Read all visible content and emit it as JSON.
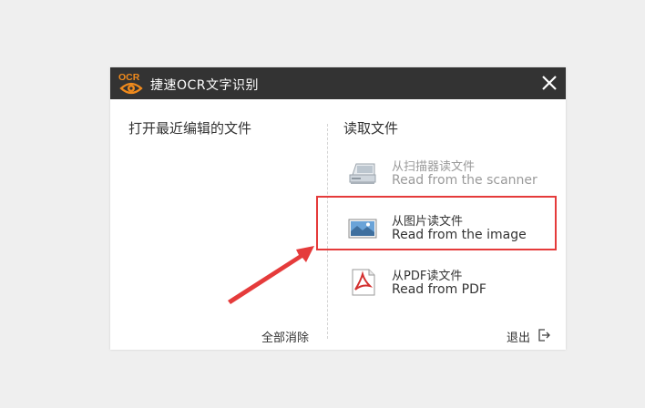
{
  "window": {
    "title": "捷速OCR文字识别",
    "logo_text": "OCR",
    "close_icon": "close-icon"
  },
  "recent": {
    "title": "打开最近编辑的文件",
    "clear_label": "全部消除"
  },
  "read": {
    "title": "读取文件",
    "options": [
      {
        "icon": "scanner-icon",
        "label_cn": "从扫描器读文件",
        "label_en": "Read from the scanner",
        "enabled": false
      },
      {
        "icon": "image-icon",
        "label_cn": "从图片读文件",
        "label_en": "Read from the image",
        "enabled": true
      },
      {
        "icon": "pdf-icon",
        "label_cn": "从PDF读文件",
        "label_en": "Read from PDF",
        "enabled": true
      }
    ],
    "exit_label": "退出",
    "exit_icon": "exit-icon"
  },
  "colors": {
    "titlebar": "#333333",
    "logo_orange": "#f08a1c",
    "annotation_red": "#e53b3b",
    "disabled_text": "#9a9a9a"
  }
}
